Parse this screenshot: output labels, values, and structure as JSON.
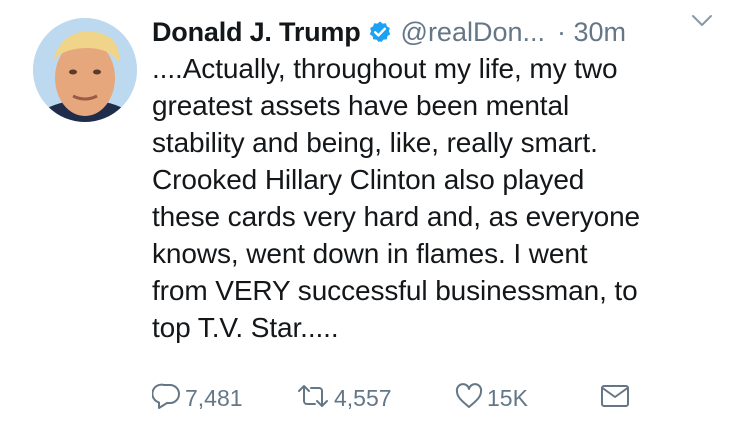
{
  "tweet": {
    "author_name": "Donald J. Trump",
    "handle": "@realDon...",
    "time": "· 30m",
    "text": "....Actually, throughout my life, my two\ngreatest assets have been mental\nstability and being, like, really smart.\nCrooked Hillary Clinton also played\nthese cards very hard and, as everyone\nknows, went down in flames. I went\nfrom VERY successful businessman, to\ntop T.V. Star.....",
    "verified": true
  },
  "actions": {
    "reply_count": "7,481",
    "retweet_count": "4,557",
    "like_count": "15K"
  },
  "colors": {
    "text": "#14171a",
    "secondary": "#657786",
    "verified_blue": "#1da1f2"
  },
  "icons": [
    "avatar-image",
    "verified-badge-icon",
    "chevron-down-icon",
    "reply-icon",
    "retweet-icon",
    "heart-icon",
    "envelope-icon"
  ]
}
